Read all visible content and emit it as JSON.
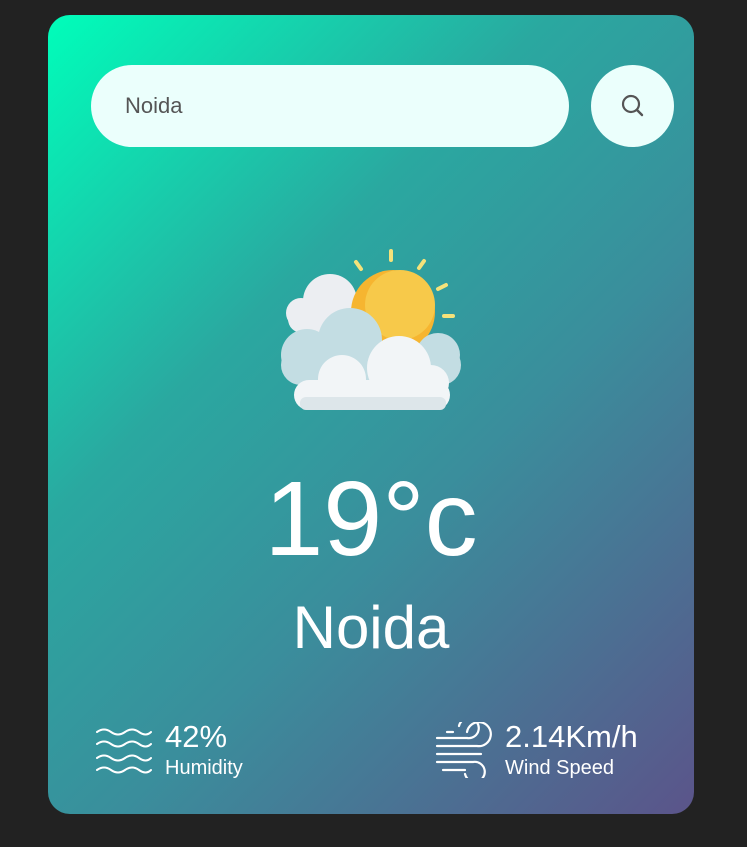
{
  "search": {
    "value": "Noida",
    "icon": "search-icon"
  },
  "weather": {
    "icon": "partly-cloudy-sun-icon",
    "temperature": "19°c",
    "city": "Noida"
  },
  "details": {
    "humidity": {
      "value": "42%",
      "label": "Humidity",
      "icon": "humidity-waves-icon"
    },
    "wind": {
      "value": "2.14Km/h",
      "label": "Wind Speed",
      "icon": "wind-icon"
    }
  },
  "colors": {
    "background": "#222222",
    "gradient_start": "#00feba",
    "gradient_end": "#5b548a",
    "input_background": "#ebfffc",
    "text": "#ffffff"
  }
}
